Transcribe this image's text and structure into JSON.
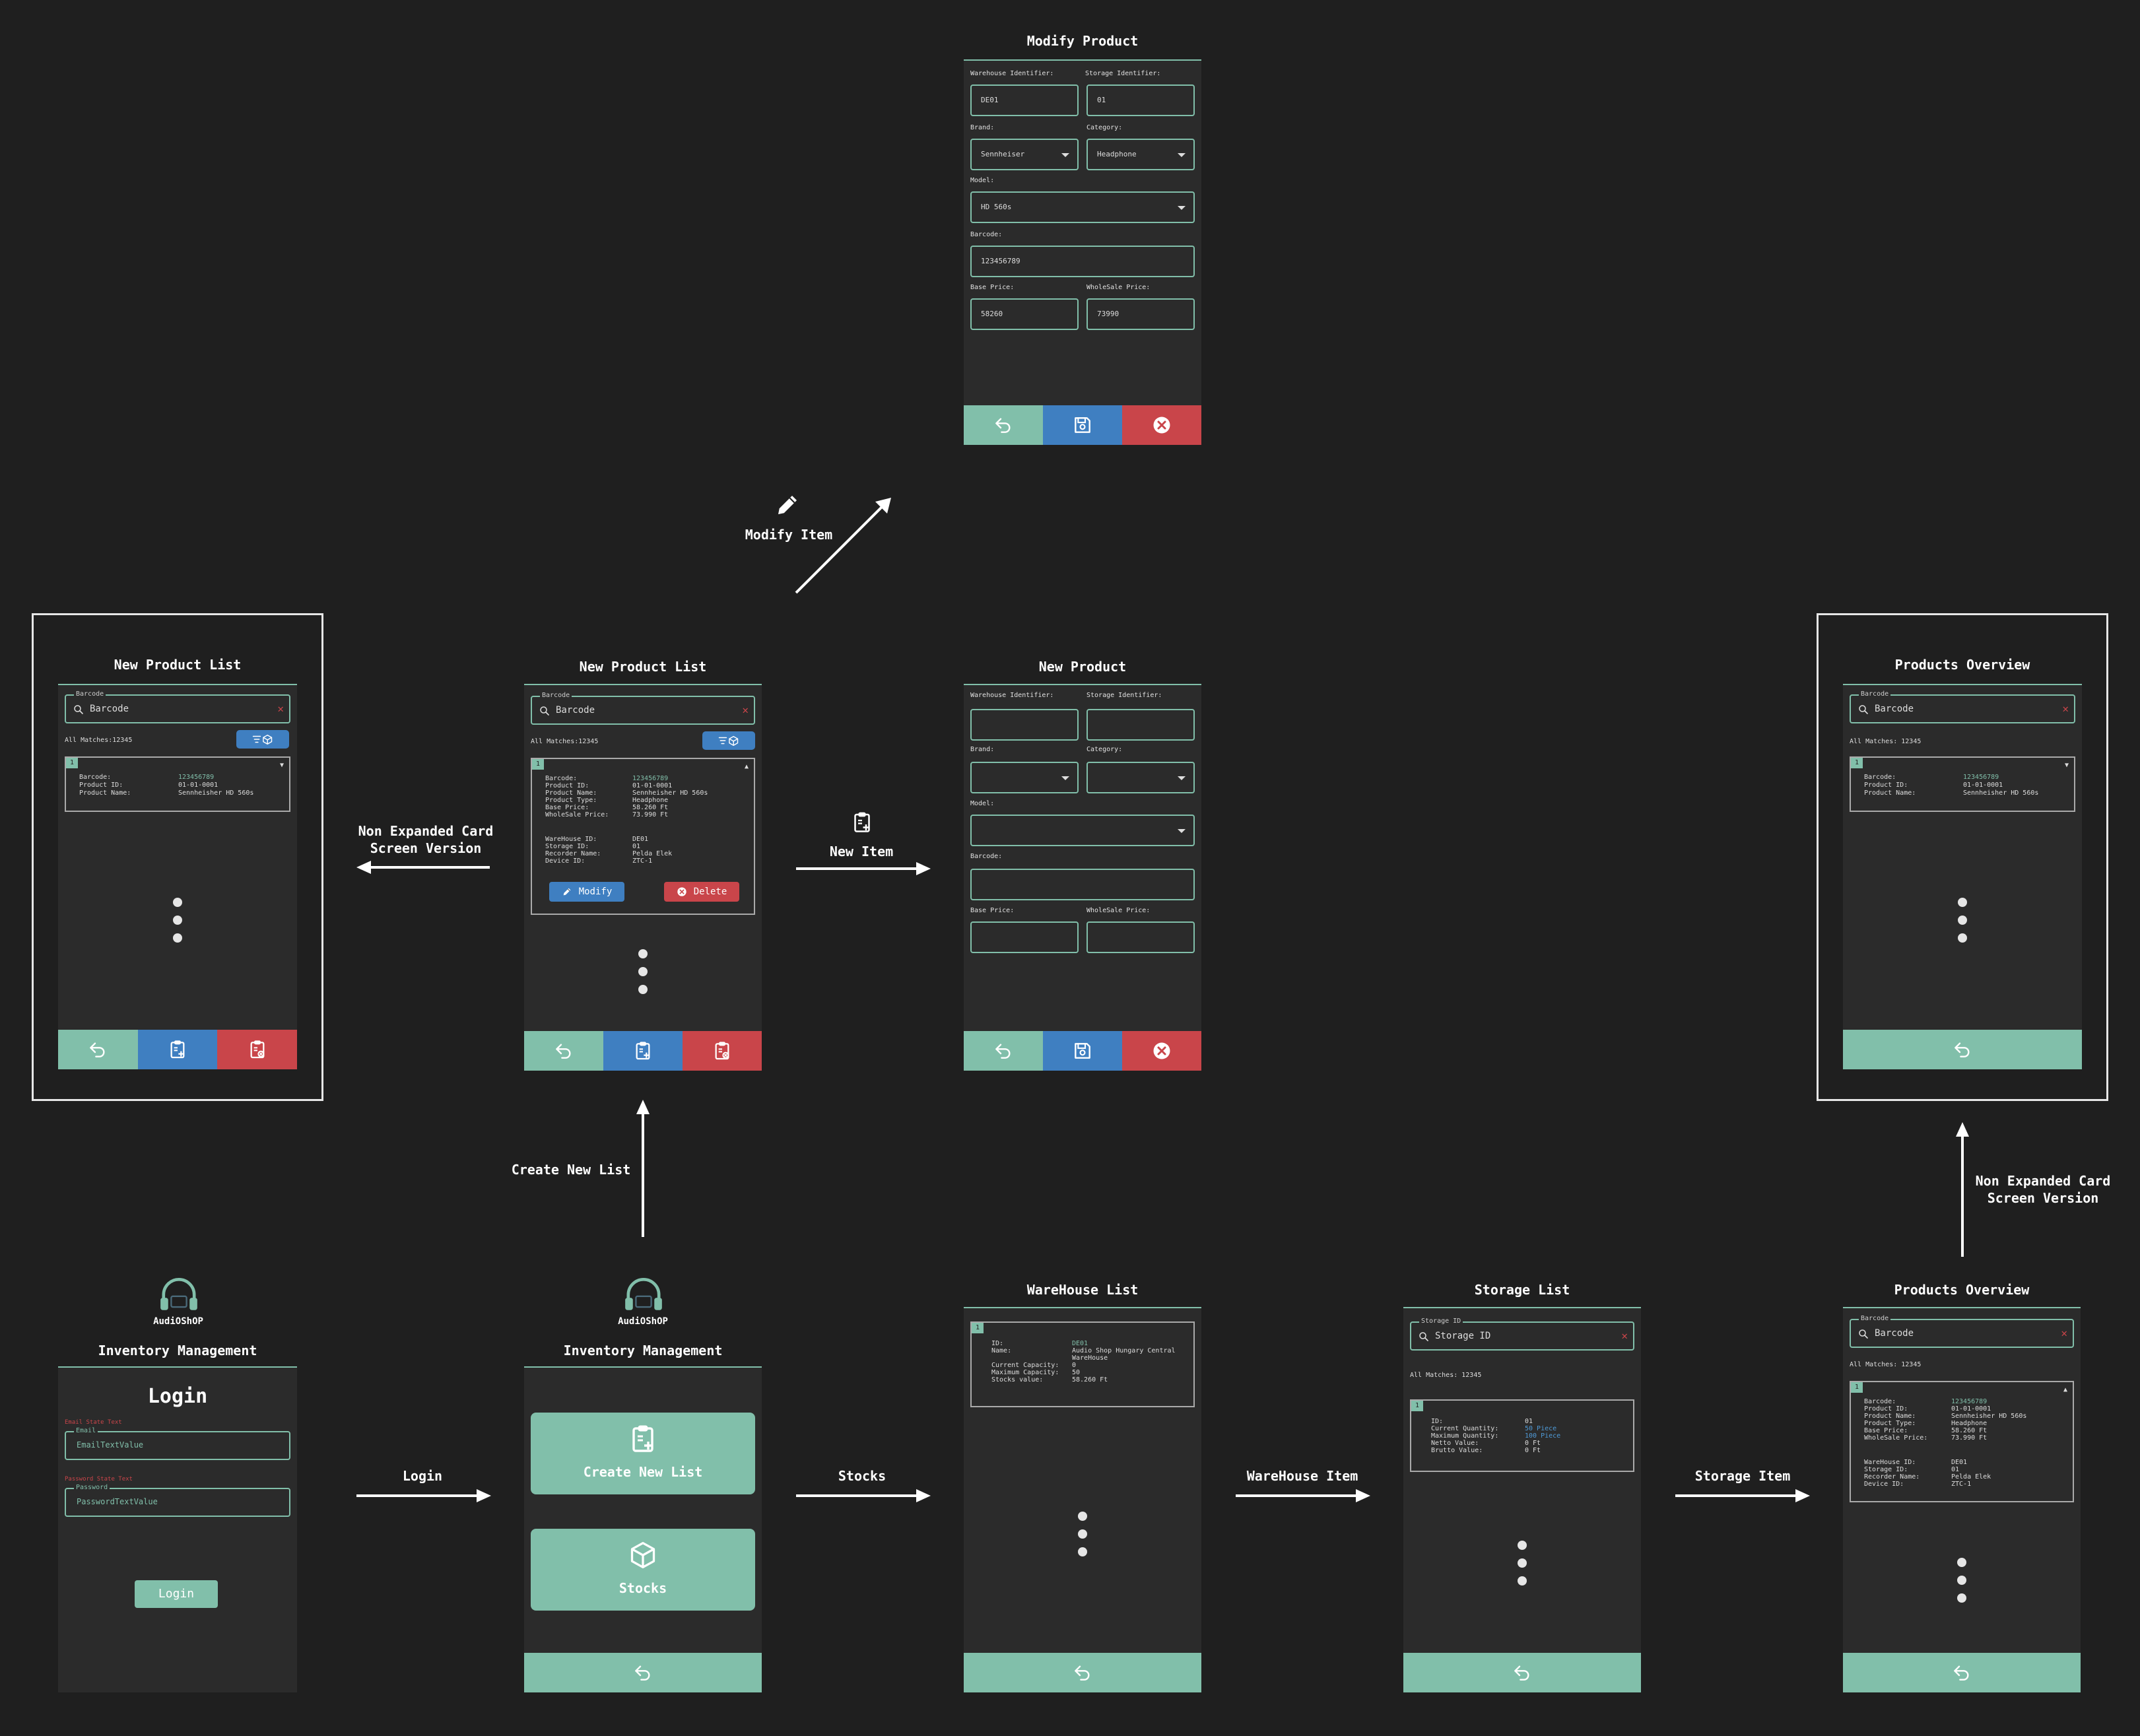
{
  "flow_labels": {
    "modify_item": "Modify Item",
    "non_expanded_left_1": "Non Expanded Card",
    "non_expanded_left_2": "Screen Version",
    "new_item": "New Item",
    "create_new_list": "Create New List",
    "non_expanded_right_1": "Non Expanded Card",
    "non_expanded_right_2": "Screen Version",
    "login": "Login",
    "stocks": "Stocks",
    "warehouse_item": "WareHouse Item",
    "storage_item": "Storage Item"
  },
  "modify_product": {
    "title": "Modify Product",
    "warehouse_label": "Warehouse Identifier:",
    "warehouse_value": "DE01",
    "storage_label": "Storage Identifier:",
    "storage_value": "01",
    "brand_label": "Brand:",
    "brand_value": "Sennheiser",
    "category_label": "Category:",
    "category_value": "Headphone",
    "model_label": "Model:",
    "model_value": "HD 560s",
    "barcode_label": "Barcode:",
    "barcode_value": "123456789",
    "base_price_label": "Base Price:",
    "base_price_value": "58260",
    "wholesale_label": "WholeSale Price:",
    "wholesale_value": "73990"
  },
  "new_product_list_collapsed": {
    "title": "New Product List",
    "search_legend": "Barcode",
    "search_placeholder": "Barcode",
    "matches": "All Matches:12345",
    "card_num": "1",
    "barcode_k": "Barcode:",
    "barcode_v": "123456789",
    "pid_k": "Product ID:",
    "pid_v": "01-01-0001",
    "pname_k": "Product Name:",
    "pname_v": "Sennheisher HD 560s"
  },
  "new_product_list_expanded": {
    "title": "New Product List",
    "search_legend": "Barcode",
    "search_placeholder": "Barcode",
    "matches": "All Matches:12345",
    "card_num": "1",
    "rows": [
      {
        "k": "Barcode:",
        "v": "123456789"
      },
      {
        "k": "Product ID:",
        "v": "01-01-0001"
      },
      {
        "k": "Product Name:",
        "v": "Sennheisher HD 560s"
      },
      {
        "k": "Product Type:",
        "v": "Headphone"
      },
      {
        "k": "Base Price:",
        "v": "58.260 Ft"
      },
      {
        "k": "WholeSale Price:",
        "v": "73.990 Ft"
      }
    ],
    "rows2": [
      {
        "k": "WareHouse ID:",
        "v": "DE01"
      },
      {
        "k": "Storage ID:",
        "v": "01"
      },
      {
        "k": "Recorder Name:",
        "v": "Pelda Elek"
      },
      {
        "k": "Device ID:",
        "v": "ZTC-1"
      }
    ],
    "modify_label": "Modify",
    "delete_label": "Delete"
  },
  "new_product": {
    "title": "New Product",
    "warehouse_label": "Warehouse Identifier:",
    "storage_label": "Storage Identifier:",
    "brand_label": "Brand:",
    "category_label": "Category:",
    "model_label": "Model:",
    "barcode_label": "Barcode:",
    "base_price_label": "Base Price:",
    "wholesale_label": "WholeSale Price:"
  },
  "products_overview_collapsed": {
    "title": "Products Overview",
    "search_legend": "Barcode",
    "search_placeholder": "Barcode",
    "matches": "All Matches:  12345",
    "card_num": "1",
    "barcode_k": "Barcode:",
    "barcode_v": "123456789",
    "pid_k": "Product ID:",
    "pid_v": "01-01-0001",
    "pname_k": "Product Name:",
    "pname_v": "Sennheisher HD 560s"
  },
  "login": {
    "logo_text": "AudiOShOP",
    "subtitle": "Inventory Management",
    "title": "Login",
    "email_state": "Email State Text",
    "email_legend": "Email",
    "email_value": "EmailTextValue",
    "password_state": "Password State Text",
    "password_legend": "Password",
    "password_value": "PasswordTextValue",
    "button": "Login"
  },
  "menu": {
    "logo_text": "AudiOShOP",
    "subtitle": "Inventory Management",
    "create_new_list": "Create New List",
    "stocks": "Stocks"
  },
  "warehouse_list": {
    "title": "WareHouse List",
    "card_num": "1",
    "rows": [
      {
        "k": "ID:",
        "v": "DE01"
      },
      {
        "k": "Name:",
        "v": "Audio Shop Hungary Central"
      },
      {
        "k": "",
        "v": "WareHouse"
      },
      {
        "k": "Current Capacity:",
        "v": "0"
      },
      {
        "k": "Maximum Capacity:",
        "v": "50"
      },
      {
        "k": "Stocks value:",
        "v": "58.260 Ft"
      }
    ]
  },
  "storage_list": {
    "title": "Storage List",
    "search_legend": "Storage ID",
    "search_placeholder": "Storage ID",
    "matches": "All Matches:  12345",
    "card_num": "1",
    "rows": [
      {
        "k": "ID:",
        "v": "01"
      },
      {
        "k": "Current Quantity:",
        "v": "50 Piece"
      },
      {
        "k": "Maximum Quantity:",
        "v": "100 Piece"
      },
      {
        "k": "Netto Value:",
        "v": "0 Ft"
      },
      {
        "k": "Brutto Value:",
        "v": "0 Ft"
      }
    ]
  },
  "products_overview_expanded": {
    "title": "Products Overview",
    "search_legend": "Barcode",
    "search_placeholder": "Barcode",
    "matches": "All Matches:  12345",
    "card_num": "1",
    "rows": [
      {
        "k": "Barcode:",
        "v": "123456789"
      },
      {
        "k": "Product ID:",
        "v": "01-01-0001"
      },
      {
        "k": "Product Name:",
        "v": "Sennheisher HD 560s"
      },
      {
        "k": "Product Type:",
        "v": "Headphone"
      },
      {
        "k": "Base Price:",
        "v": "58.260 Ft"
      },
      {
        "k": "WholeSale Price:",
        "v": "73.990 Ft"
      }
    ],
    "rows2": [
      {
        "k": "WareHouse ID:",
        "v": "DE01"
      },
      {
        "k": "Storage ID:",
        "v": "01"
      },
      {
        "k": "Recorder Name:",
        "v": "Pelda Elek"
      },
      {
        "k": "Device ID:",
        "v": "ZTC-1"
      }
    ]
  },
  "colors": {
    "background": "#1f1f1f",
    "screen": "#2b2b2b",
    "accent_green": "#81bfaa",
    "accent_blue": "#3f7fc1",
    "accent_red": "#c9454a"
  },
  "icons": [
    "back-icon",
    "save-icon",
    "close-icon",
    "new-list-icon",
    "delete-list-icon",
    "pencil-icon",
    "search-icon",
    "box-icon",
    "headphones-logo-icon"
  ]
}
